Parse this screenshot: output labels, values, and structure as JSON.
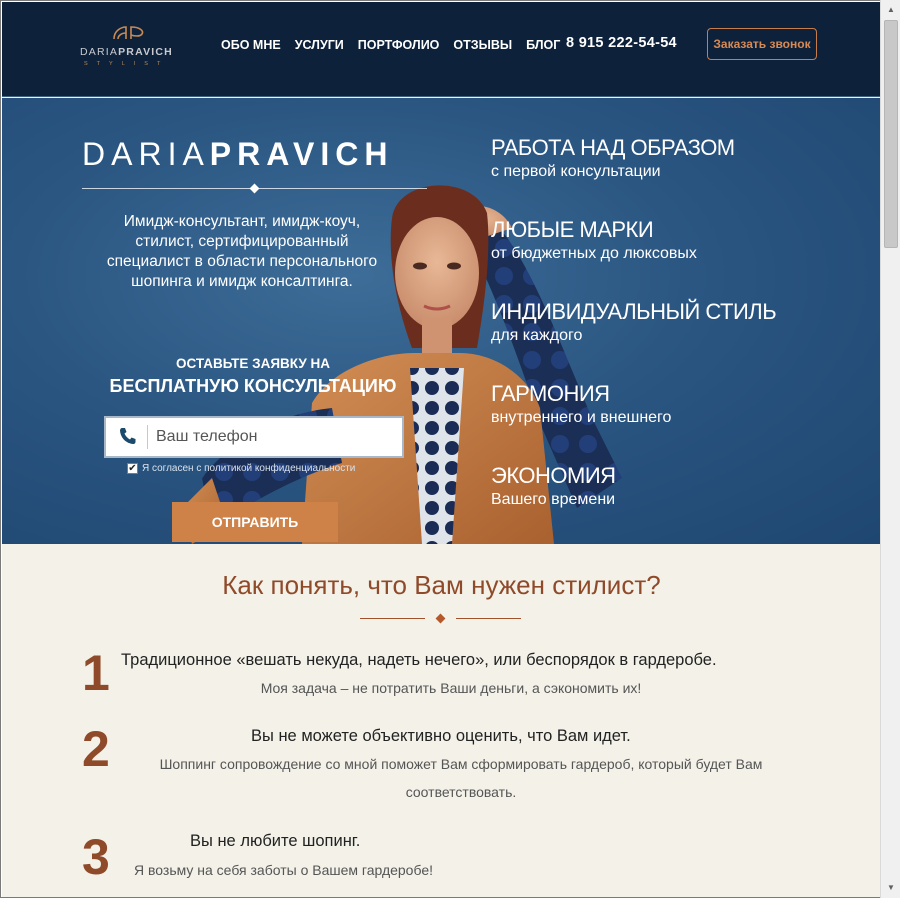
{
  "header": {
    "logo_name_1": "DARIA",
    "logo_name_2": "PRAVICH",
    "logo_sub": "STYLIST",
    "nav": [
      "ОБО МНЕ",
      "УСЛУГИ",
      "ПОРТФОЛИО",
      "ОТЗЫВЫ",
      "БЛОГ"
    ],
    "phone": "8 915 222-54-54",
    "call_button": "Заказать звонок"
  },
  "hero": {
    "brand_1": "DARIA",
    "brand_2": "PRAVICH",
    "description": "Имидж-консультант, имидж-коуч, стилист, сертифицированный специалист в области персонального шопинга и имидж консалтинга.",
    "cta_line1": "ОСТАВЬТЕ ЗАЯВКУ НА",
    "cta_line2": "БЕСПЛАТНУЮ КОНСУЛЬТАЦИЮ",
    "phone_placeholder": "Ваш телефон",
    "agree_checked": true,
    "agree_label": "Я согласен с политикой конфиденциальности",
    "submit": "ОТПРАВИТЬ",
    "benefits": [
      {
        "title": "РАБОТА НАД ОБРАЗОМ",
        "sub": "с первой консультации"
      },
      {
        "title": "ЛЮБЫЕ МАРКИ",
        "sub": "от бюджетных до люксовых"
      },
      {
        "title": "ИНДИВИДУАЛЬНЫЙ СТИЛЬ",
        "sub": "для каждого"
      },
      {
        "title": "ГАРМОНИЯ",
        "sub": "внутреннего и внешнего"
      },
      {
        "title": "ЭКОНОМИЯ",
        "sub": "Вашего времени"
      }
    ]
  },
  "section": {
    "title": "Как понять, что Вам нужен стилист?",
    "reasons": [
      {
        "num": "1",
        "title": "Традиционное «вешать некуда, надеть нечего», или беспорядок в гардеробе.",
        "text": "Моя задача – не потратить Ваши деньги, а сэкономить их!"
      },
      {
        "num": "2",
        "title": "Вы не можете объективно оценить, что Вам идет.",
        "text": "Шоппинг сопровождение со мной поможет Вам сформировать гардероб, который будет Вам соответствовать."
      },
      {
        "num": "3",
        "title": "Вы не любите шопинг.",
        "text": "Я возьму на себя заботы о Вашем гардеробе!"
      }
    ]
  },
  "colors": {
    "header_bg": "#0d223a",
    "hero_bg": "#2b5682",
    "accent": "#cf8248",
    "section_bg": "#f3f1e8",
    "heading_brown": "#8f4a2a"
  }
}
